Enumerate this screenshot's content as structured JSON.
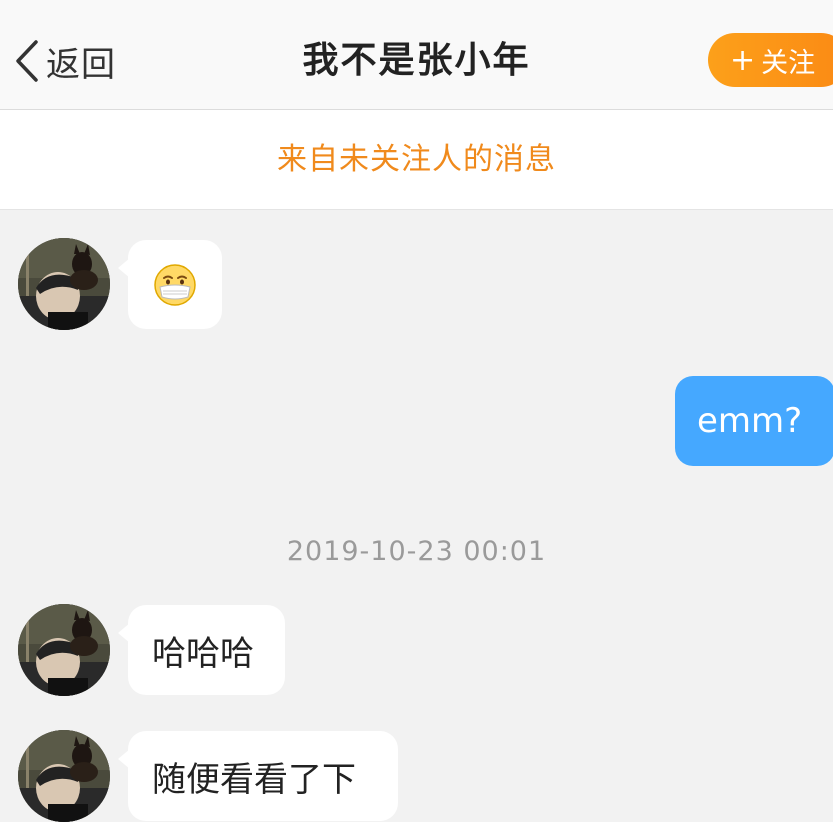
{
  "nav": {
    "back_label": "返回",
    "title": "我不是张小年",
    "follow_plus": "+",
    "follow_label": "关注"
  },
  "notice": {
    "text": "来自未关注人的消息"
  },
  "messages": [
    {
      "side": "incoming",
      "type": "emoji",
      "icon": "mask-face-emoji"
    },
    {
      "side": "outgoing",
      "type": "text",
      "text": "emm?"
    },
    {
      "type": "timestamp",
      "text": "2019-10-23 00:01"
    },
    {
      "side": "incoming",
      "type": "text",
      "text": "哈哈哈"
    },
    {
      "side": "incoming",
      "type": "text",
      "text": "随便看看了下"
    }
  ],
  "colors": {
    "accent_orange": "#fb8a14",
    "notice_orange": "#f08a1c",
    "outgoing_bubble": "#45a8ff",
    "background": "#f2f2f2"
  }
}
